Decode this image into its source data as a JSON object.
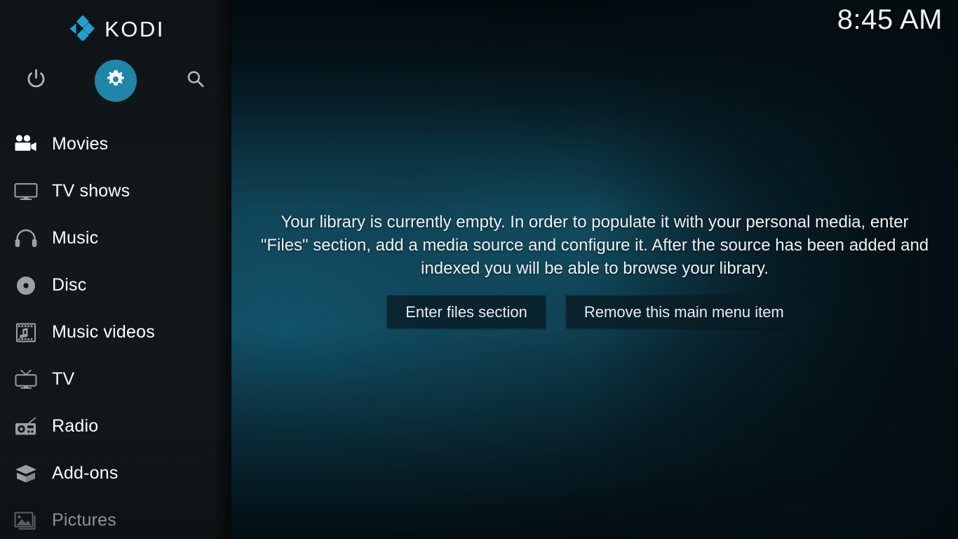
{
  "app": {
    "name": "KODI",
    "logo_icon": "kodi-logo-icon",
    "accent_color": "#1e86a8",
    "sidebar_bg": "#121819"
  },
  "header": {
    "clock": "8:45 AM"
  },
  "nav": {
    "items": [
      {
        "icon": "power-icon",
        "name": "power-button",
        "label": "Power"
      },
      {
        "icon": "gear-icon",
        "name": "settings-button",
        "label": "Settings",
        "selected": true
      },
      {
        "icon": "search-icon",
        "name": "search-button",
        "label": "Search"
      }
    ]
  },
  "sidebar": {
    "items": [
      {
        "label": "Movies",
        "icon": "movie-camera-icon",
        "state": "selected"
      },
      {
        "label": "TV shows",
        "icon": "monitor-icon",
        "state": "normal"
      },
      {
        "label": "Music",
        "icon": "headphones-icon",
        "state": "normal"
      },
      {
        "label": "Disc",
        "icon": "disc-icon",
        "state": "normal"
      },
      {
        "label": "Music videos",
        "icon": "film-note-icon",
        "state": "normal"
      },
      {
        "label": "TV",
        "icon": "tv-antenna-icon",
        "state": "normal"
      },
      {
        "label": "Radio",
        "icon": "radio-icon",
        "state": "normal"
      },
      {
        "label": "Add-ons",
        "icon": "package-box-icon",
        "state": "normal"
      },
      {
        "label": "Pictures",
        "icon": "picture-icon",
        "state": "dim"
      }
    ]
  },
  "main": {
    "empty_message": "Your library is currently empty. In order to populate it with your personal media, enter \"Files\" section, add a media source and configure it. After the source has been added and indexed you will be able to browse your library.",
    "buttons": [
      {
        "label": "Enter files section",
        "name": "enter-files-section-button"
      },
      {
        "label": "Remove this main menu item",
        "name": "remove-main-menu-item-button"
      }
    ]
  }
}
